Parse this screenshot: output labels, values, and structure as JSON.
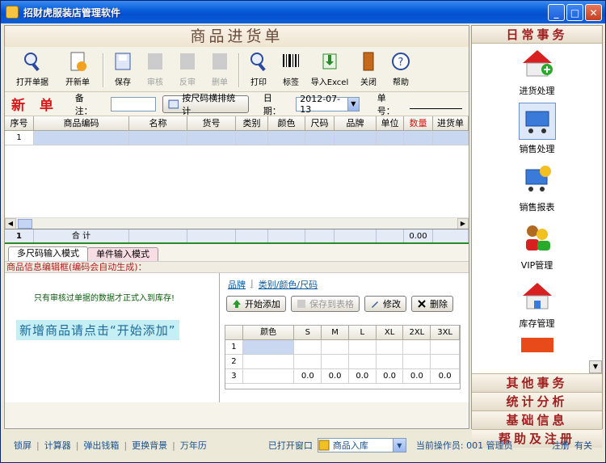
{
  "window": {
    "title": "招财虎服装店管理软件"
  },
  "form": {
    "title": "商品进货单"
  },
  "toolbar": [
    {
      "label": "打开单据",
      "icon": "open-icon",
      "enabled": true
    },
    {
      "label": "开新单",
      "icon": "new-doc-icon",
      "enabled": true
    },
    {
      "label": "保存",
      "icon": "save-icon",
      "enabled": true
    },
    {
      "label": "审核",
      "icon": "approve-icon",
      "enabled": false
    },
    {
      "label": "反审",
      "icon": "unapprove-icon",
      "enabled": false
    },
    {
      "label": "删单",
      "icon": "delete-doc-icon",
      "enabled": false
    },
    {
      "label": "打印",
      "icon": "print-icon",
      "enabled": true
    },
    {
      "label": "标签",
      "icon": "barcode-icon",
      "enabled": true
    },
    {
      "label": "导入Excel",
      "icon": "import-excel-icon",
      "enabled": true
    },
    {
      "label": "关闭",
      "icon": "close-door-icon",
      "enabled": true
    },
    {
      "label": "帮助",
      "icon": "help-icon",
      "enabled": true
    }
  ],
  "header": {
    "status": "新 单",
    "remark_label": "备 注：",
    "remark_value": "",
    "size_stats_button": "按尺码横排统计",
    "date_label": "日期：",
    "date_value": "2012-07-13",
    "number_label": "单号：",
    "number_value": ""
  },
  "grid": {
    "columns": [
      "序号",
      "商品编码",
      "名称",
      "货号",
      "类别",
      "颜色",
      "尺码",
      "品牌",
      "单位",
      "数量",
      "进货单价"
    ],
    "rows": [
      [
        "1",
        "",
        "",
        "",
        "",
        "",
        "",
        "",
        "",
        "",
        ""
      ]
    ],
    "total_row": {
      "index": "1",
      "label": "合 计",
      "qty": "0.00"
    }
  },
  "tabs": [
    "多尺码输入模式",
    "单件输入模式"
  ],
  "edit": {
    "label": "商品信息编辑框(编码会自动生成)：",
    "note": "只有审核过单据的数据才正式入到库存!",
    "hint": "新增商品请点击“开始添加”",
    "links": [
      "品牌",
      "类别/颜色/尺码"
    ],
    "buttons": {
      "start_add": "开始添加",
      "save_to_table": "保存到表格",
      "modify": "修改",
      "delete": "删除"
    },
    "size_grid": {
      "columns": [
        "颜色",
        "S",
        "M",
        "L",
        "XL",
        "2XL",
        "3XL"
      ],
      "rows": [
        [
          "1",
          "",
          "",
          "",
          "",
          "",
          ""
        ],
        [
          "2",
          "",
          "",
          "",
          "",
          "",
          ""
        ],
        [
          "3",
          "",
          "0.0",
          "0.0",
          "0.0",
          "0.0",
          "0.0",
          "0.0"
        ]
      ]
    }
  },
  "sidebar": {
    "header": "日常事务",
    "items": [
      {
        "label": "进货处理",
        "icon": "purchase-house-icon"
      },
      {
        "label": "销售处理",
        "icon": "shopping-cart-icon",
        "selected": true
      },
      {
        "label": "销售报表",
        "icon": "sales-report-icon"
      },
      {
        "label": "VIP管理",
        "icon": "vip-users-icon"
      },
      {
        "label": "库存管理",
        "icon": "inventory-house-icon"
      }
    ],
    "footer": [
      "其他事务",
      "统计分析",
      "基础信息",
      "帮助及注册"
    ]
  },
  "status": {
    "links": [
      "锁屏",
      "计算器",
      "弹出钱箱",
      "更换背景",
      "万年历"
    ],
    "opened_label": "已打开窗口",
    "opened_value": "商品入库",
    "operator": "当前操作员: 001 管理员",
    "register": "注册",
    "about": "有关"
  }
}
